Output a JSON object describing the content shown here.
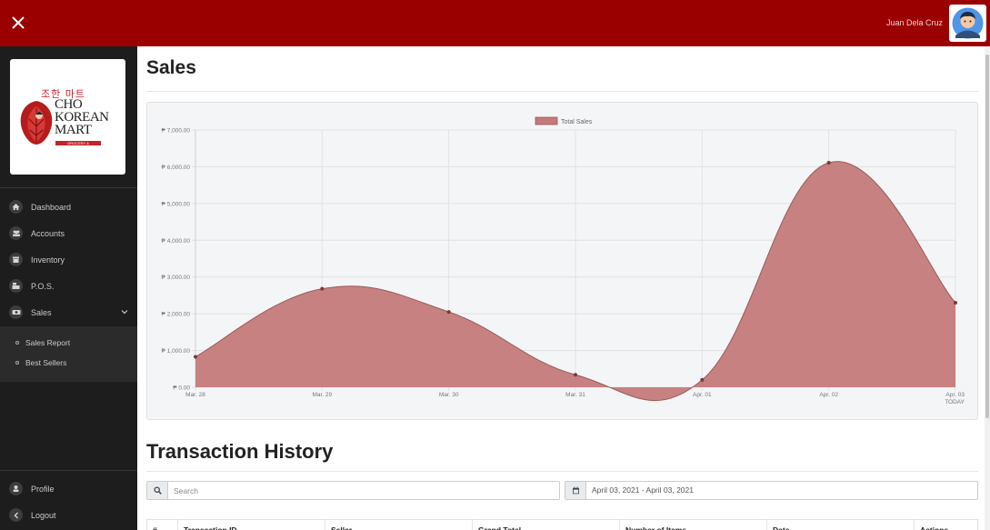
{
  "header": {
    "user_name": "Juan Dela Cruz",
    "brand_color": "#9b0000"
  },
  "logo": {
    "korean": "조한 마트",
    "line1": "CHO",
    "line2": "KOREAN",
    "line3": "MART",
    "sub": "GROCERY & RESTAURANT"
  },
  "sidebar": {
    "items": [
      {
        "label": "Dashboard",
        "icon": "home-icon"
      },
      {
        "label": "Accounts",
        "icon": "users-icon"
      },
      {
        "label": "Inventory",
        "icon": "box-icon"
      },
      {
        "label": "P.O.S.",
        "icon": "register-icon"
      },
      {
        "label": "Sales",
        "icon": "money-icon"
      }
    ],
    "submenu": [
      {
        "label": "Sales Report"
      },
      {
        "label": "Best Sellers"
      }
    ],
    "bottom": [
      {
        "label": "Profile",
        "icon": "user-icon"
      },
      {
        "label": "Logout",
        "icon": "chevron-left-icon"
      }
    ]
  },
  "main": {
    "sales_title": "Sales",
    "transactions_title": "Transaction History",
    "search_placeholder": "Search",
    "date_range": "April 03, 2021 - April 03, 2021",
    "table_headers": [
      "#",
      "Transaction ID",
      "Seller",
      "Grand Total",
      "Number of Items",
      "Date",
      "Actions"
    ]
  },
  "chart_data": {
    "type": "area",
    "title": "",
    "legend": "Total Sales",
    "legend_position": "top-center",
    "grid": true,
    "categories": [
      "Mar. 28",
      "Mar. 29",
      "Mar. 30",
      "Mar. 31",
      "Apr. 01",
      "Apr. 02",
      "Apr. 03"
    ],
    "x_sublabels": [
      "",
      "",
      "",
      "",
      "",
      "",
      "TODAY"
    ],
    "series": [
      {
        "name": "Total Sales",
        "values": [
          830,
          2680,
          2050,
          340,
          200,
          6110,
          2300
        ],
        "color": "#c47a7a"
      }
    ],
    "ylim": [
      0,
      7000
    ],
    "y_ticks": [
      0,
      1000,
      2000,
      3000,
      4000,
      5000,
      6000,
      7000
    ],
    "y_tick_labels": [
      "₱ 0.00",
      "₱ 1,000.00",
      "₱ 2,000.00",
      "₱ 3,000.00",
      "₱ 4,000.00",
      "₱ 5,000.00",
      "₱ 6,000.00",
      "₱ 7,000.00"
    ]
  }
}
